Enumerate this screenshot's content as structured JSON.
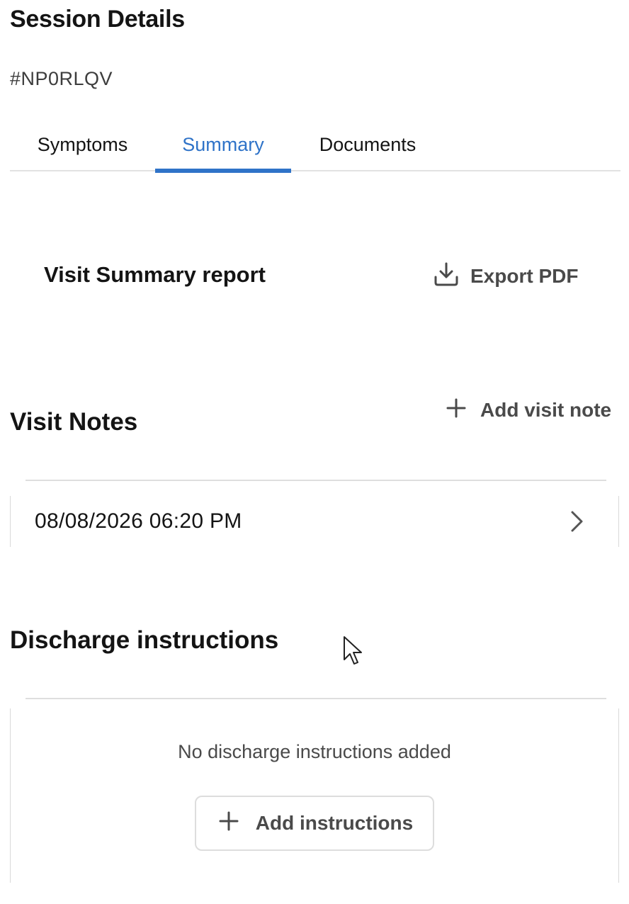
{
  "header": {
    "title": "Session Details",
    "session_id": "#NP0RLQV"
  },
  "tabs": [
    {
      "label": "Symptoms",
      "active": false
    },
    {
      "label": "Summary",
      "active": true
    },
    {
      "label": "Documents",
      "active": false
    }
  ],
  "summary_report": {
    "title": "Visit Summary report",
    "export_label": "Export PDF",
    "export_icon": "download-icon"
  },
  "visit_notes": {
    "title": "Visit Notes",
    "add_label": "Add visit note",
    "add_icon": "plus-icon",
    "items": [
      {
        "datetime": "08/08/2026 06:20 PM",
        "icon": "chevron-right-icon"
      }
    ]
  },
  "discharge": {
    "title": "Discharge instructions",
    "empty_text": "No discharge instructions added",
    "add_label": "Add instructions",
    "add_icon": "plus-icon"
  },
  "colors": {
    "accent": "#2f73c8",
    "text": "#141414",
    "muted": "#4a4a4a",
    "divider": "#dedede"
  }
}
